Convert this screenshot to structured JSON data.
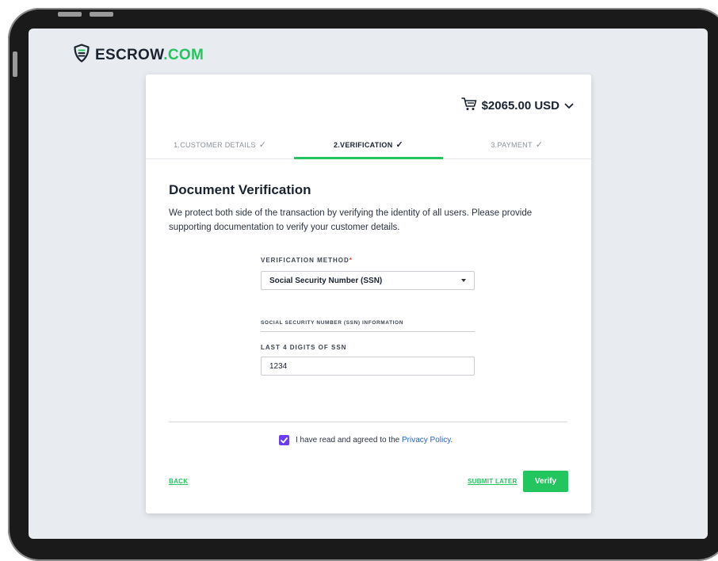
{
  "brand": {
    "name_main": "ESCROW",
    "name_accent": ".COM",
    "accent_color": "#23c55e",
    "icon": "shield-icon"
  },
  "cart": {
    "total": "$2065.00 USD",
    "icon": "cart-icon"
  },
  "steps": [
    {
      "label": "1.CUSTOMER DETAILS",
      "completed": true,
      "active": false
    },
    {
      "label": "2.VERIFICATION",
      "completed": true,
      "active": true
    },
    {
      "label": "3.PAYMENT",
      "completed": true,
      "active": false
    }
  ],
  "verification": {
    "title": "Document Verification",
    "description": "We protect both side of the transaction by verifying the identity of all users. Please provide supporting documentation to verify your customer details.",
    "method_label": "VERIFICATION METHOD",
    "required_mark": "*",
    "method_value": "Social Security Number (SSN)",
    "section_label": "SOCIAL SECURITY NUMBER (SSN) INFORMATION",
    "ssn_label": "LAST 4 DIGITS OF SSN",
    "ssn_value": "1234"
  },
  "agreement": {
    "checked": true,
    "text": "I have read and agreed to the ",
    "link": "Privacy Policy",
    "suffix": "."
  },
  "actions": {
    "back": "BACK",
    "submit_later": "SUBMIT LATER",
    "verify": "Verify"
  }
}
